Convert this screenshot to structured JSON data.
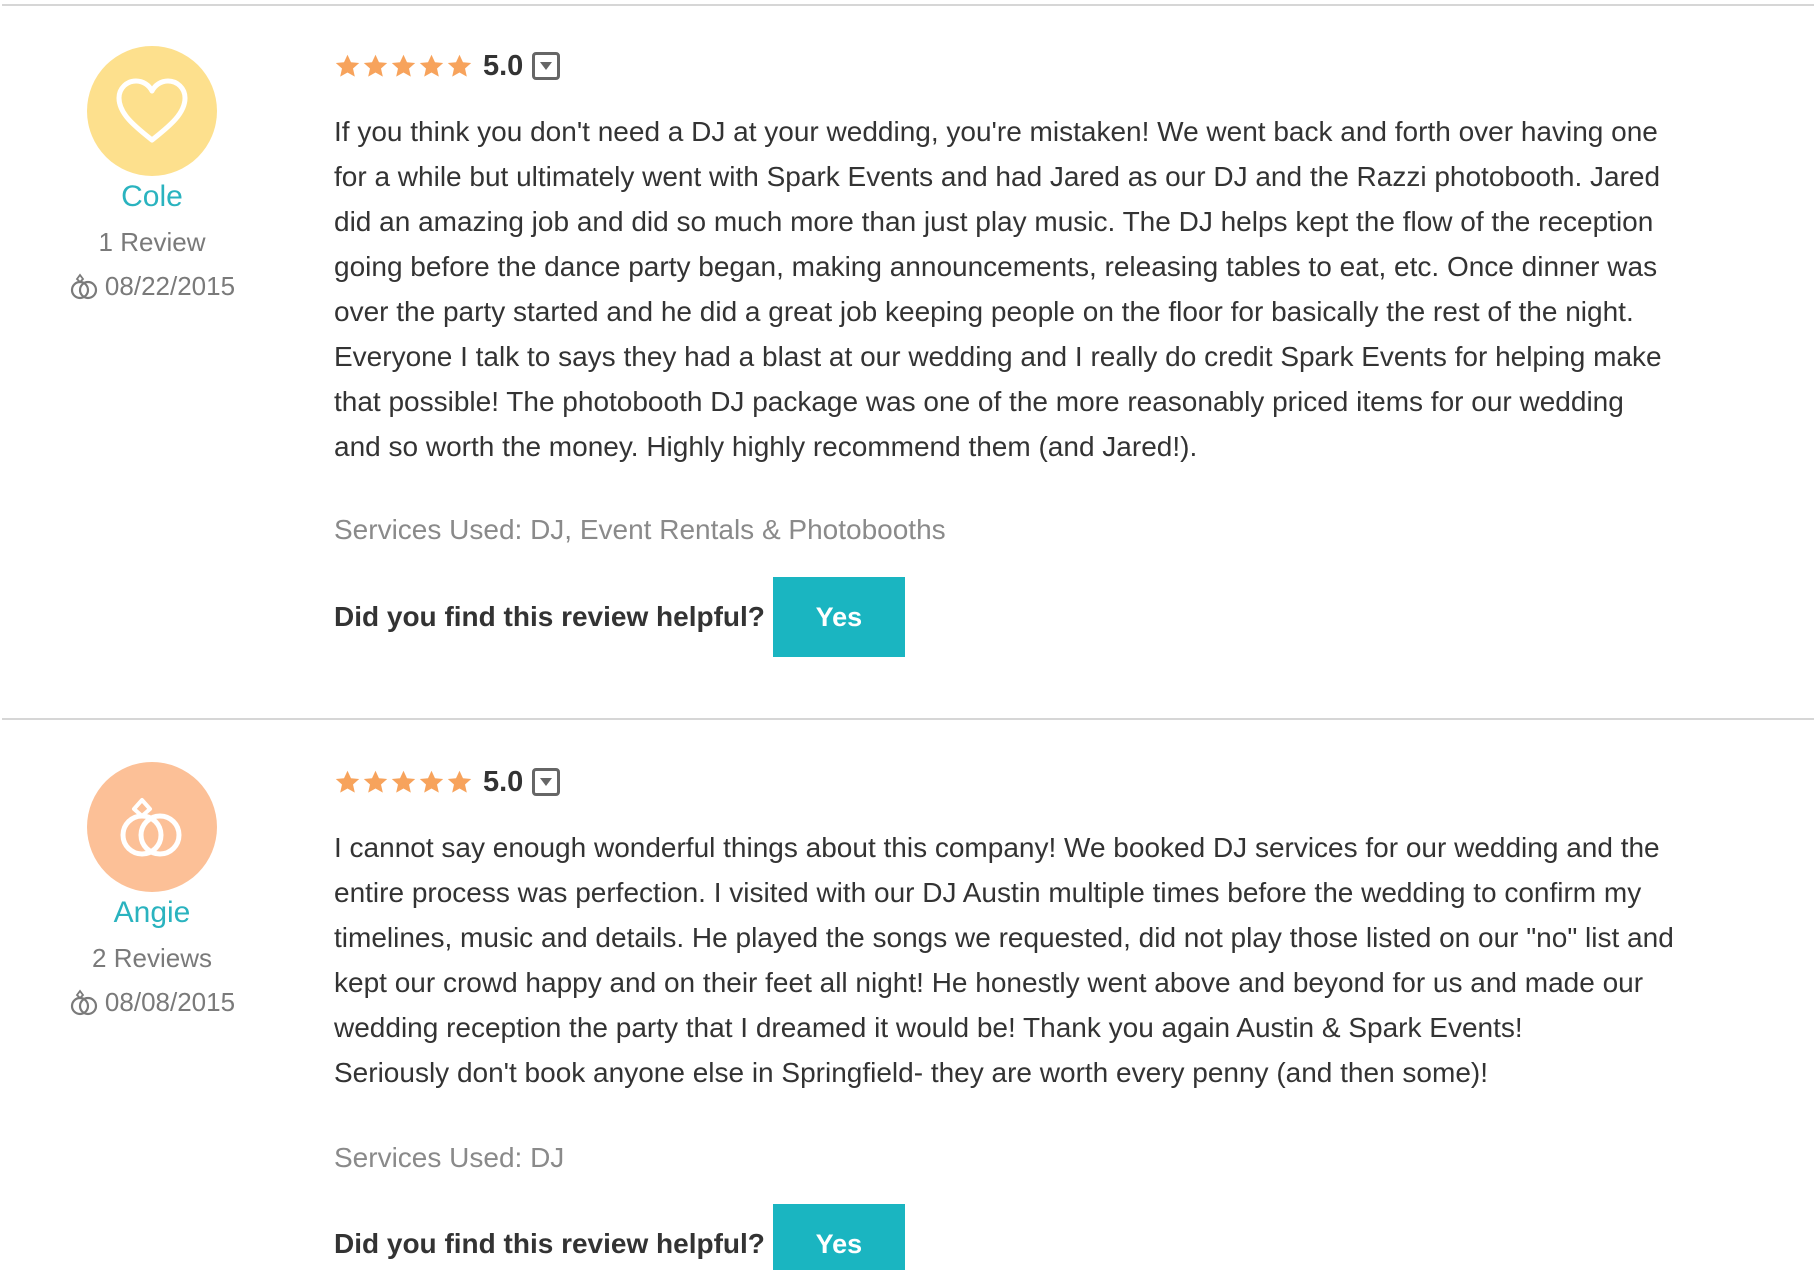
{
  "colors": {
    "accent": "#1ab5c1",
    "star": "#f7a35c",
    "avatar_cole": "#fde08d",
    "avatar_angie": "#fcc097",
    "name": "#2ab3bf"
  },
  "reviews": [
    {
      "reviewer": {
        "name": "Cole",
        "review_count": "1 Review",
        "wedding_date": "08/22/2015",
        "avatar_icon": "heart-icon"
      },
      "rating_value": "5.0",
      "rating": 5,
      "body_lines": [
        "If you think you don't need a DJ at your wedding, you're mistaken! We went back and forth over having one",
        "for a while but ultimately went with Spark Events and had Jared as our DJ and the Razzi photobooth. Jared",
        "did an amazing job and did so much more than just play music. The DJ helps kept the flow of the reception",
        "going before the dance party began, making announcements, releasing tables to eat, etc. Once dinner was",
        "over the party started and he did a great job keeping people on the floor for basically the rest of the night.",
        "Everyone I talk to says they had a blast at our wedding and I really do credit Spark Events for helping make",
        "that possible! The photobooth DJ package was one of the more reasonably priced items for our wedding",
        "and so worth the money. Highly highly recommend them (and Jared!)."
      ],
      "services_used": "Services Used: DJ, Event Rentals & Photobooths",
      "helpful_question": "Did you find this review helpful?",
      "helpful_button": "Yes"
    },
    {
      "reviewer": {
        "name": "Angie",
        "review_count": "2 Reviews",
        "wedding_date": "08/08/2015",
        "avatar_icon": "rings-icon"
      },
      "rating_value": "5.0",
      "rating": 5,
      "body_lines": [
        "I cannot say enough wonderful things about this company! We booked DJ services for our wedding and the",
        "entire process was perfection. I visited with our DJ Austin multiple times before the wedding to confirm my",
        "timelines, music and details. He played the songs we requested, did not play those listed on our \"no\" list and",
        "kept our crowd happy and on their feet all night! He honestly went above and beyond for us and made our",
        "wedding reception the party that I dreamed it would be! Thank you again Austin & Spark Events!",
        "Seriously don't book anyone else in Springfield- they are worth every penny (and then some)!"
      ],
      "services_used": "Services Used: DJ",
      "helpful_question": "Did you find this review helpful?",
      "helpful_button": "Yes"
    }
  ]
}
